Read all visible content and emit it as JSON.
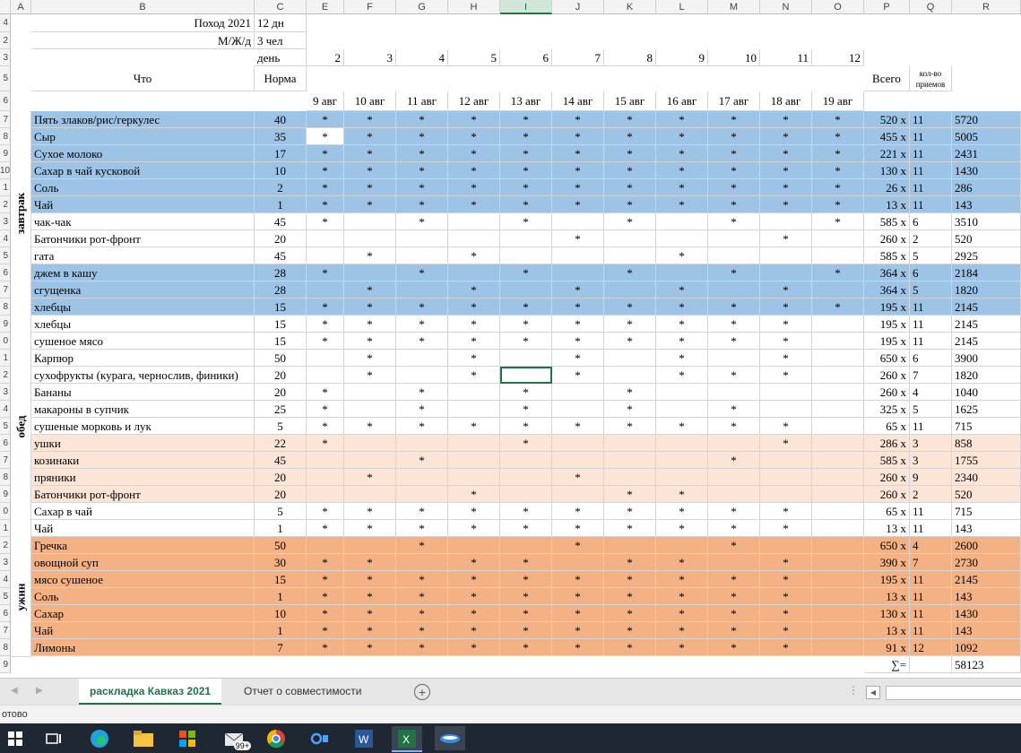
{
  "columns": [
    "A",
    "B",
    "C",
    "E",
    "F",
    "G",
    "H",
    "I",
    "J",
    "K",
    "L",
    "M",
    "N",
    "O",
    "P",
    "Q",
    "R"
  ],
  "row_numbers": [
    "4",
    "2",
    "3",
    "5",
    "6",
    "7",
    "8",
    "9",
    "10",
    "1",
    "2",
    "3",
    "4",
    "5",
    "6",
    "7",
    "8",
    "9",
    "0",
    "1",
    "2",
    "3",
    "4",
    "5",
    "6",
    "7",
    "8",
    "9",
    "0",
    "1",
    "2",
    "3",
    "4",
    "5",
    "6",
    "7",
    "8",
    "9"
  ],
  "header": {
    "title": "Поход 2021",
    "days": "12 дн",
    "group_label": "М/Ж/д",
    "people": "3 чел",
    "day_label": "день",
    "what": "Что",
    "norm": "Норма",
    "total": "Всего",
    "count_label": "кол-во приемов",
    "day_numbers": [
      "2",
      "3",
      "4",
      "5",
      "6",
      "7",
      "8",
      "9",
      "10",
      "11",
      "12"
    ],
    "dates": [
      "9 авг",
      "10 авг",
      "11 авг",
      "12 авг",
      "13 авг",
      "14 авг",
      "15 авг",
      "16 авг",
      "17 авг",
      "18 авг",
      "19 авг"
    ]
  },
  "meal_labels": [
    "завтрак",
    "обед",
    "ужин"
  ],
  "rows": [
    {
      "name": "Пять злаков/рис/геркулес",
      "norm": "40",
      "marks": "***********",
      "total": "520 x",
      "count": "11",
      "sum": "5720",
      "color": "blue"
    },
    {
      "name": "Сыр",
      "norm": "35",
      "marks": "***********",
      "total": "455 x",
      "count": "11",
      "sum": "5005",
      "color": "blue"
    },
    {
      "name": "Сухое молоко",
      "norm": "17",
      "marks": "***********",
      "total": "221 x",
      "count": "11",
      "sum": "2431",
      "color": "blue"
    },
    {
      "name": "Сахар в чай кусковой",
      "norm": "10",
      "marks": "***********",
      "total": "130 x",
      "count": "11",
      "sum": "1430",
      "color": "blue"
    },
    {
      "name": "Соль",
      "norm": "2",
      "marks": "***********",
      "total": "26 x",
      "count": "11",
      "sum": "286",
      "color": "blue"
    },
    {
      "name": "Чай",
      "norm": "1",
      "marks": "***********",
      "total": "13 x",
      "count": "11",
      "sum": "143",
      "color": "blue"
    },
    {
      "name": "чак-чак",
      "norm": "45",
      "marks": "* * * * * *",
      "total": "585 x",
      "count": "6",
      "sum": "3510",
      "color": "white"
    },
    {
      "name": "Батончики рот-фронт",
      "norm": "20",
      "marks": "     *   * ",
      "total": "260 x",
      "count": "2",
      "sum": "520",
      "color": "white"
    },
    {
      "name": "гата",
      "norm": "45",
      "marks": " * *   *   ",
      "total": "585 x",
      "count": "5",
      "sum": "2925",
      "color": "white"
    },
    {
      "name": "джем в кашу",
      "norm": "28",
      "marks": "* * * * * *",
      "total": "364 x",
      "count": "6",
      "sum": "2184",
      "color": "blue"
    },
    {
      "name": "сгущенка",
      "norm": "28",
      "marks": " * * * * * ",
      "total": "364 x",
      "count": "5",
      "sum": "1820",
      "color": "blue"
    },
    {
      "name": "хлебцы",
      "norm": "15",
      "marks": "***********",
      "total": "195 x",
      "count": "11",
      "sum": "2145",
      "color": "blue"
    },
    {
      "name": "хлебцы",
      "norm": "15",
      "marks": "********** ",
      "total": "195 x",
      "count": "11",
      "sum": "2145",
      "color": "white"
    },
    {
      "name": "сушеное мясо",
      "norm": "15",
      "marks": "********** ",
      "total": "195 x",
      "count": "11",
      "sum": "2145",
      "color": "white"
    },
    {
      "name": "Карпюр",
      "norm": "50",
      "marks": " * * * * * ",
      "total": "650 x",
      "count": "6",
      "sum": "3900",
      "color": "white"
    },
    {
      "name": "сухофрукты (курага, чернослив, финики)",
      "norm": "20",
      "marks": " * * * *** ",
      "total": "260 x",
      "count": "7",
      "sum": "1820",
      "color": "white"
    },
    {
      "name": "Бананы",
      "norm": "20",
      "marks": "* * * *    ",
      "total": "260 x",
      "count": "4",
      "sum": "1040",
      "color": "white"
    },
    {
      "name": "макароны в супчик",
      "norm": "25",
      "marks": "* * * * *  ",
      "total": "325 x",
      "count": "5",
      "sum": "1625",
      "color": "white"
    },
    {
      "name": "сушеные морковь и лук",
      "norm": "5",
      "marks": "********** ",
      "total": "65 x",
      "count": "11",
      "sum": "715",
      "color": "white"
    },
    {
      "name": "ушки",
      "norm": "22",
      "marks": "*   *    * ",
      "total": "286 x",
      "count": "3",
      "sum": "858",
      "color": "peach"
    },
    {
      "name": "козинаки",
      "norm": "45",
      "marks": "  *     *  ",
      "total": "585 x",
      "count": "3",
      "sum": "1755",
      "color": "peach"
    },
    {
      "name": "пряники",
      "norm": "20",
      "marks": " *   *     ",
      "total": "260 x",
      "count": "9",
      "sum": "2340",
      "color": "peach"
    },
    {
      "name": "Батончики рот-фронт",
      "norm": "20",
      "marks": "   *  **   ",
      "total": "260 x",
      "count": "2",
      "sum": "520",
      "color": "peach"
    },
    {
      "name": "Сахар в чай",
      "norm": "5",
      "marks": "********** ",
      "total": "65 x",
      "count": "11",
      "sum": "715",
      "color": "white"
    },
    {
      "name": "Чай",
      "norm": "1",
      "marks": "********** ",
      "total": "13 x",
      "count": "11",
      "sum": "143",
      "color": "white"
    },
    {
      "name": "Гречка",
      "norm": "50",
      "marks": "  *  *  *  ",
      "total": "650 x",
      "count": "4",
      "sum": "2600",
      "color": "orange"
    },
    {
      "name": "овощной суп",
      "norm": "30",
      "marks": "** ** ** * ",
      "total": "390 x",
      "count": "7",
      "sum": "2730",
      "color": "orange"
    },
    {
      "name": "мясо сушеное",
      "norm": "15",
      "marks": "********** ",
      "total": "195 x",
      "count": "11",
      "sum": "2145",
      "color": "orange"
    },
    {
      "name": "Соль",
      "norm": "1",
      "marks": "********** ",
      "total": "13 x",
      "count": "11",
      "sum": "143",
      "color": "orange"
    },
    {
      "name": "Сахар",
      "norm": "10",
      "marks": "********** ",
      "total": "130 x",
      "count": "11",
      "sum": "1430",
      "color": "orange"
    },
    {
      "name": "Чай",
      "norm": "1",
      "marks": "********** ",
      "total": "13 x",
      "count": "11",
      "sum": "143",
      "color": "orange"
    },
    {
      "name": "Лимоны",
      "norm": "7",
      "marks": "********** ",
      "total": "91 x",
      "count": "12",
      "sum": "1092",
      "color": "orange"
    }
  ],
  "footer": {
    "sum_label": "∑=",
    "grand_total": "58123"
  },
  "tabs": [
    "раскладка Кавказ 2021",
    "Отчет о совместимости"
  ],
  "add_sheet_icon": "plus-circle-icon",
  "status": "отово",
  "taskbar_badge": "99+",
  "colors": {
    "blue": "#9dc3e6",
    "peach": "#fce4d6",
    "orange": "#f4b183",
    "excel_green": "#217346"
  }
}
